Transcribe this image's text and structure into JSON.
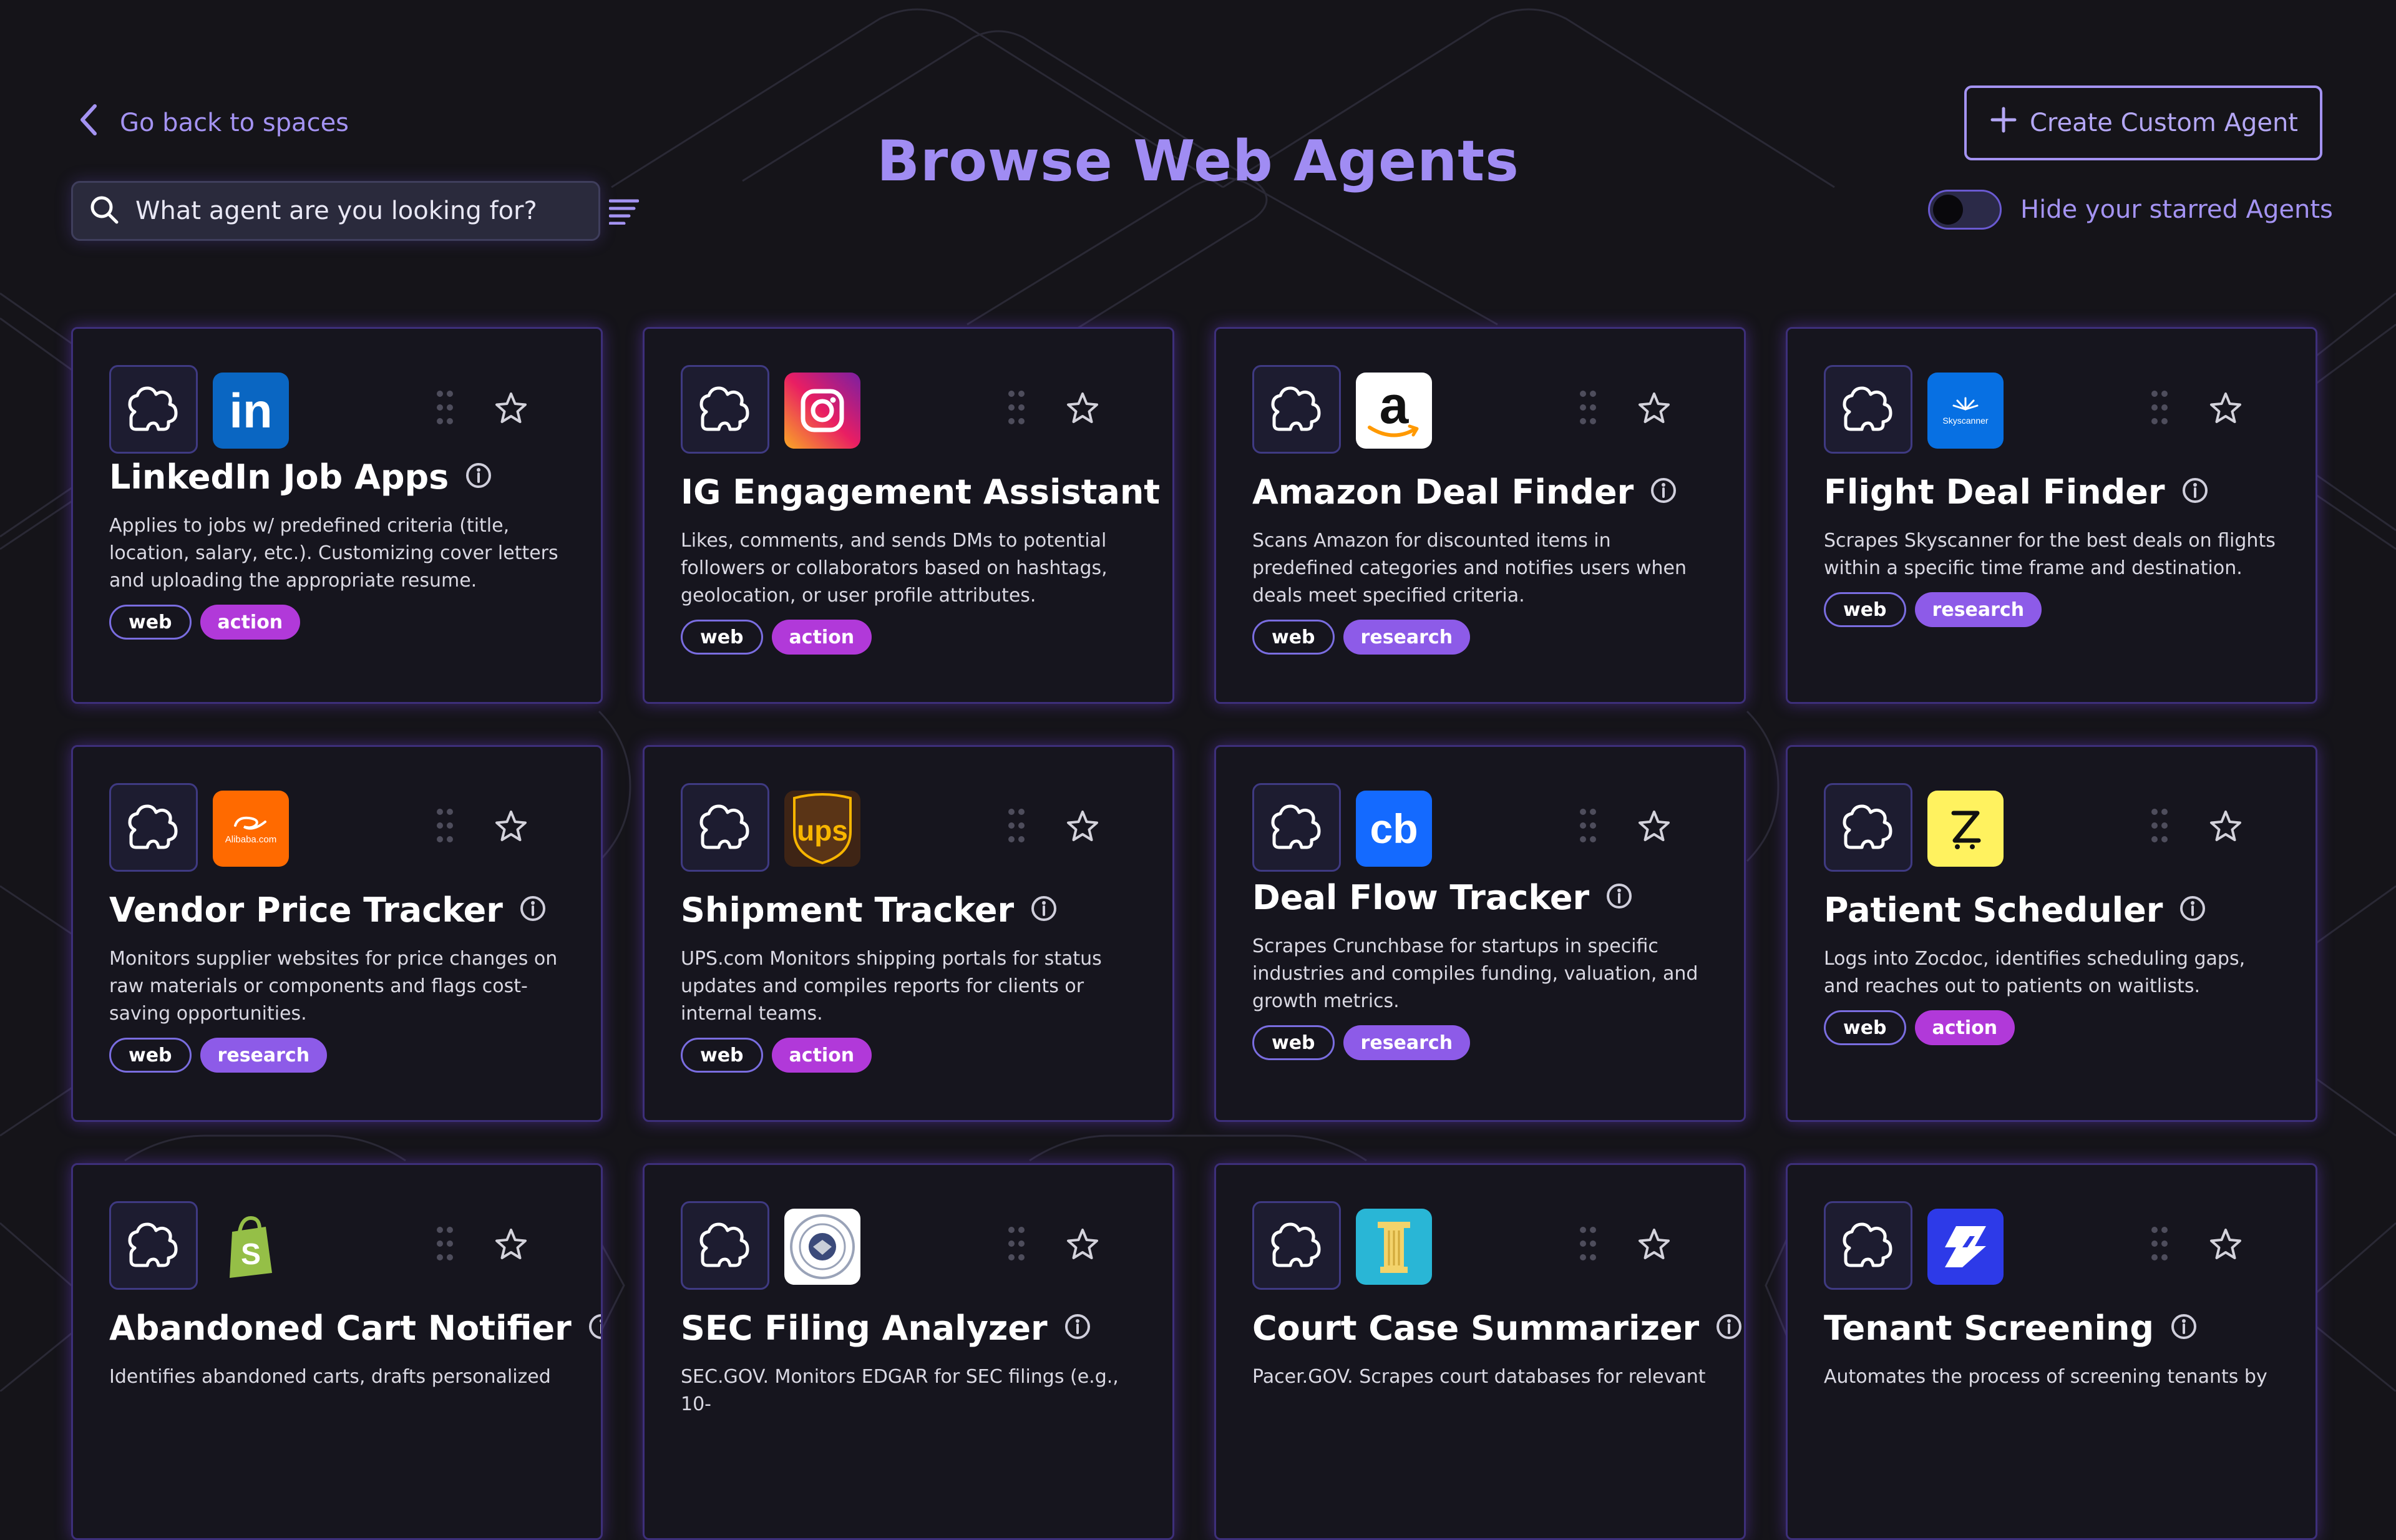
{
  "nav": {
    "back_label": "Go back to spaces"
  },
  "search": {
    "placeholder": "What agent are you looking for?"
  },
  "header": {
    "title": "Browse Web Agents",
    "create_label": "Create Custom Agent"
  },
  "toggle": {
    "label": "Hide your starred Agents",
    "on": false
  },
  "colors": {
    "accent": "#a493f2",
    "background": "#151419",
    "card": "#16151e",
    "action_tag": "#b139d9",
    "research_tag": "#8d5be8"
  },
  "cards": [
    {
      "name": "LinkedIn Job Apps",
      "brand_icon": "linkedin-icon",
      "brand_text": "in",
      "desc": "Applies to jobs w/ predefined criteria (title, location, salary, etc.). Customizing cover letters and uploading the appropriate resume.",
      "tags": [
        "web",
        "action"
      ]
    },
    {
      "name": "IG Engagement Assistant",
      "brand_icon": "instagram-icon",
      "brand_text": "",
      "desc": "Likes, comments, and sends DMs to potential followers or collaborators based on hashtags, geolocation, or user profile attributes.",
      "tags": [
        "web",
        "action"
      ]
    },
    {
      "name": "Amazon Deal Finder",
      "brand_icon": "amazon-icon",
      "brand_text": "a",
      "desc": "Scans Amazon for discounted items in predefined categories and notifies users when deals meet specified criteria.",
      "tags": [
        "web",
        "research"
      ]
    },
    {
      "name": "Flight Deal Finder",
      "brand_icon": "skyscanner-icon",
      "brand_text": "Skyscanner",
      "desc": "Scrapes Skyscanner for the best deals on flights within a specific time frame and destination.",
      "tags": [
        "web",
        "research"
      ]
    },
    {
      "name": "Vendor Price Tracker",
      "brand_icon": "alibaba-icon",
      "brand_text": "Alibaba.com",
      "desc": "Monitors supplier websites for price changes on raw materials or components and flags cost-saving opportunities.",
      "tags": [
        "web",
        "research"
      ]
    },
    {
      "name": "Shipment Tracker",
      "brand_icon": "ups-icon",
      "brand_text": "ups",
      "desc": "UPS.com Monitors shipping portals for status updates and compiles reports for clients or internal teams.",
      "tags": [
        "web",
        "action"
      ]
    },
    {
      "name": "Deal Flow Tracker",
      "brand_icon": "crunchbase-icon",
      "brand_text": "cb",
      "desc": "Scrapes Crunchbase for startups in specific industries and compiles funding, valuation, and growth metrics.",
      "tags": [
        "web",
        "research"
      ]
    },
    {
      "name": "Patient Scheduler",
      "brand_icon": "zocdoc-icon",
      "brand_text": "Z",
      "desc": "Logs into Zocdoc, identifies scheduling gaps, and reaches out to patients on waitlists.",
      "tags": [
        "web",
        "action"
      ]
    },
    {
      "name": "Abandoned Cart Notifier",
      "brand_icon": "shopify-icon",
      "brand_text": "S",
      "desc": "Identifies abandoned carts, drafts personalized",
      "tags": []
    },
    {
      "name": "SEC Filing Analyzer",
      "brand_icon": "sec-seal-icon",
      "brand_text": "",
      "desc": "SEC.GOV. Monitors EDGAR for SEC filings (e.g., 10-",
      "tags": []
    },
    {
      "name": "Court Case Summarizer",
      "brand_icon": "pacer-icon",
      "brand_text": "",
      "desc": "Pacer.GOV. Scrapes court databases for relevant",
      "tags": []
    },
    {
      "name": "Tenant Screening",
      "brand_icon": "tenant-app-icon",
      "brand_text": "",
      "desc": "Automates the process of screening tenants by",
      "tags": []
    }
  ]
}
